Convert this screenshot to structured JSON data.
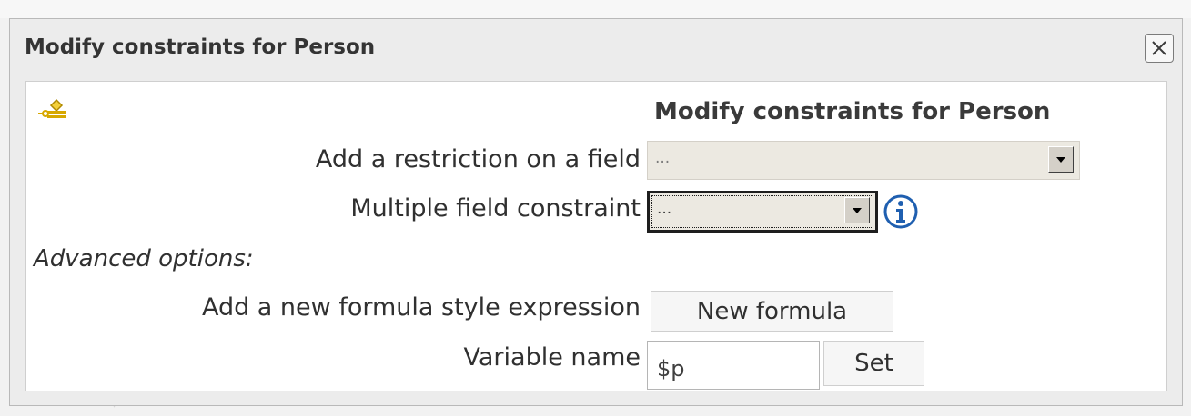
{
  "dialog": {
    "title": "Modify constraints for Person",
    "heading": "Modify constraints for Person",
    "icons": {
      "close": "close-icon",
      "constraint": "constraint-icon",
      "info": "info-icon",
      "dropdown": "chevron-down-icon"
    },
    "restriction": {
      "label": "Add a restriction on a field",
      "selected": "..."
    },
    "multiple": {
      "label": "Multiple field constraint",
      "selected": "..."
    },
    "advanced_label": "Advanced options:",
    "formula": {
      "label": "Add a new formula style expression",
      "button": "New formula"
    },
    "variable": {
      "label": "Variable name",
      "value": "$p",
      "button": "Set"
    }
  },
  "colors": {
    "dialog_bg": "#ececec",
    "content_bg": "#ffffff",
    "select_bg": "#ece9e1",
    "info_blue": "#1f5fb0",
    "icon_gold": "#d7a800"
  }
}
